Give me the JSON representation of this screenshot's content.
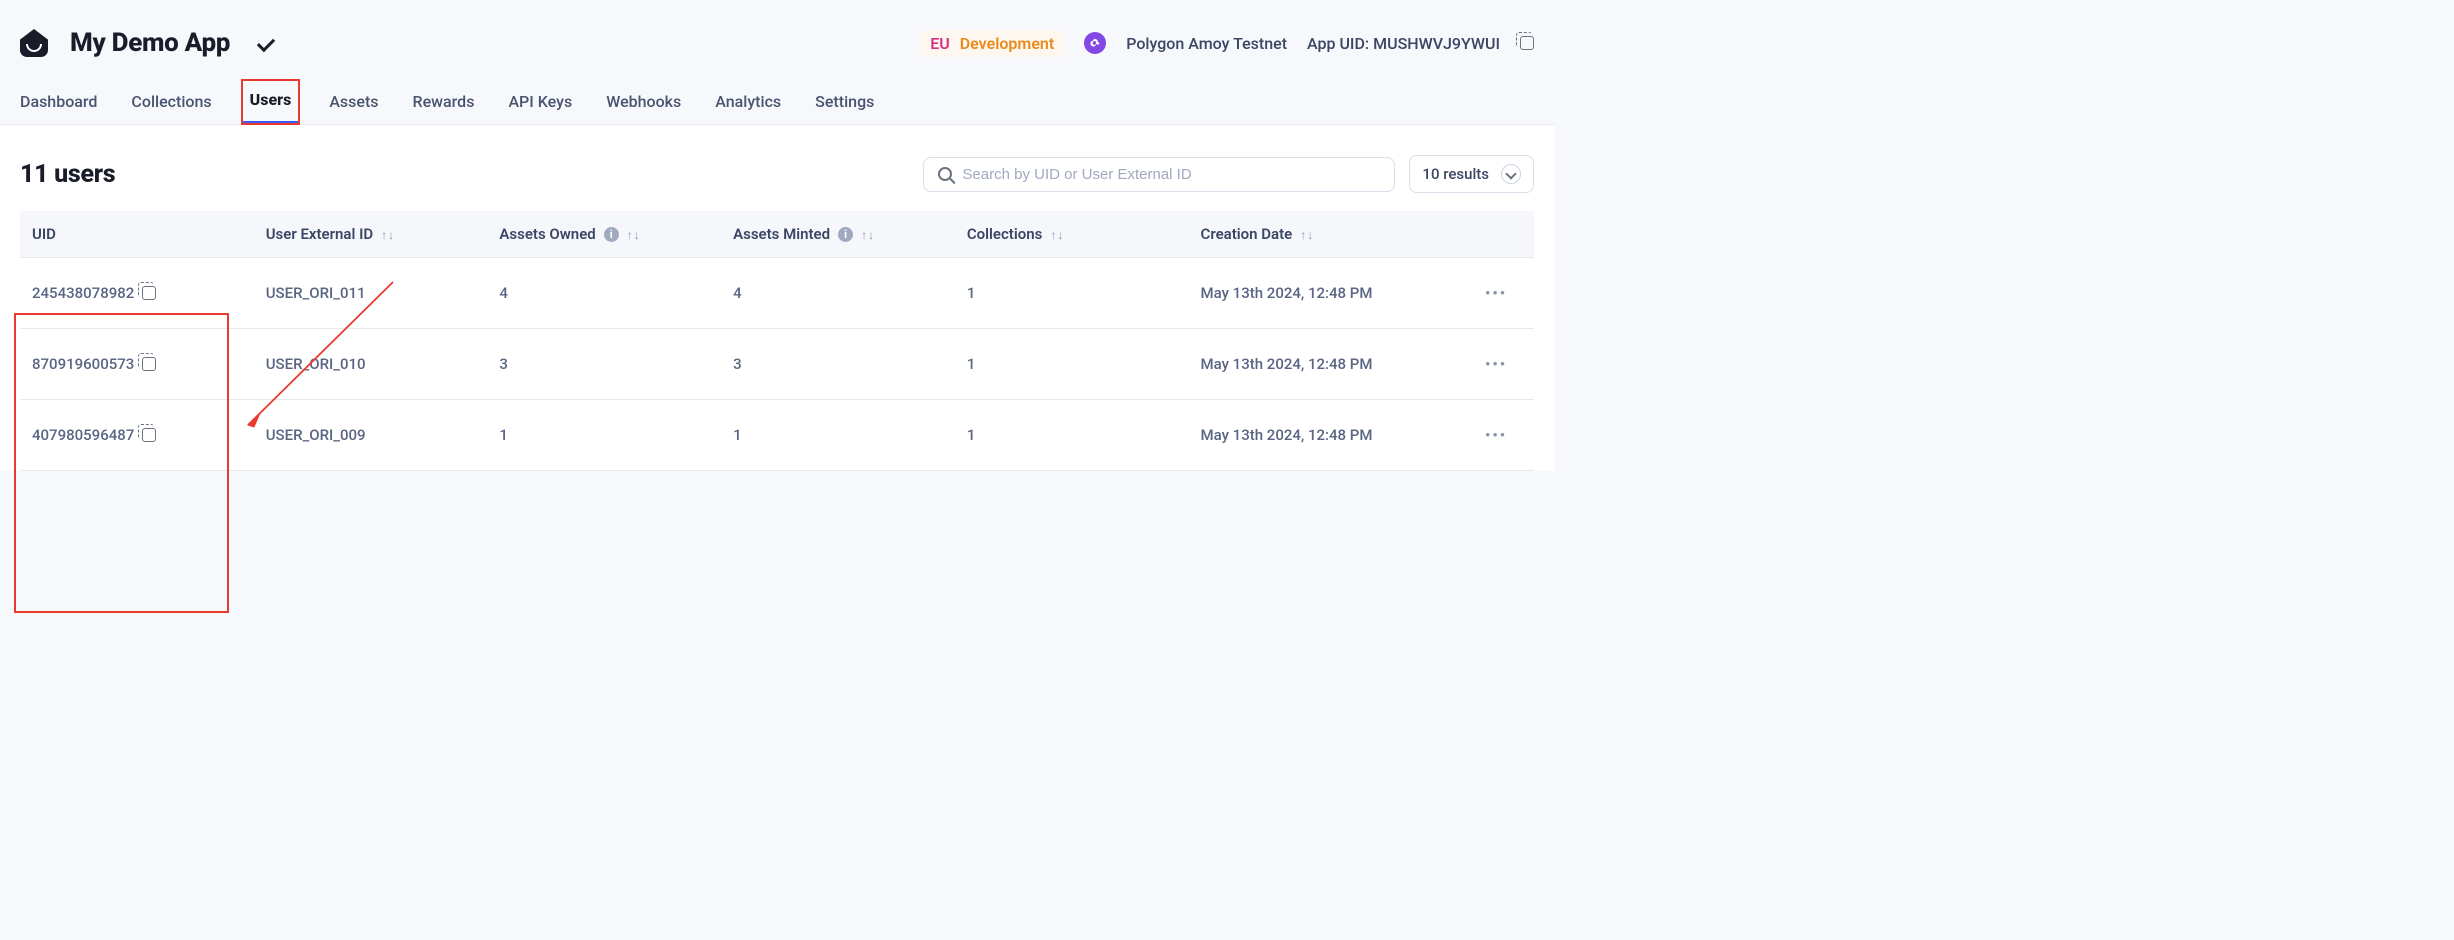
{
  "header": {
    "app_name": "My Demo App",
    "eu_badge": "EU",
    "env_badge": "Development",
    "network_name": "Polygon Amoy Testnet",
    "app_uid_label": "App UID: MUSHWVJ9YWUI"
  },
  "tabs": [
    {
      "label": "Dashboard",
      "active": false
    },
    {
      "label": "Collections",
      "active": false
    },
    {
      "label": "Users",
      "active": true
    },
    {
      "label": "Assets",
      "active": false
    },
    {
      "label": "Rewards",
      "active": false
    },
    {
      "label": "API Keys",
      "active": false
    },
    {
      "label": "Webhooks",
      "active": false
    },
    {
      "label": "Analytics",
      "active": false
    },
    {
      "label": "Settings",
      "active": false
    }
  ],
  "page": {
    "title": "11 users",
    "search_placeholder": "Search by UID or User External ID",
    "results_label": "10 results"
  },
  "columns": {
    "uid": "UID",
    "ext_id": "User External ID",
    "owned": "Assets Owned",
    "minted": "Assets Minted",
    "collections": "Collections",
    "created": "Creation Date"
  },
  "rows": [
    {
      "uid": "245438078982",
      "ext_id": "USER_ORI_011",
      "owned": "4",
      "minted": "4",
      "collections": "1",
      "created": "May 13th 2024, 12:48 PM"
    },
    {
      "uid": "870919600573",
      "ext_id": "USER_ORI_010",
      "owned": "3",
      "minted": "3",
      "collections": "1",
      "created": "May 13th 2024, 12:48 PM"
    },
    {
      "uid": "407980596487",
      "ext_id": "USER_ORI_009",
      "owned": "1",
      "minted": "1",
      "collections": "1",
      "created": "May 13th 2024, 12:48 PM"
    }
  ]
}
